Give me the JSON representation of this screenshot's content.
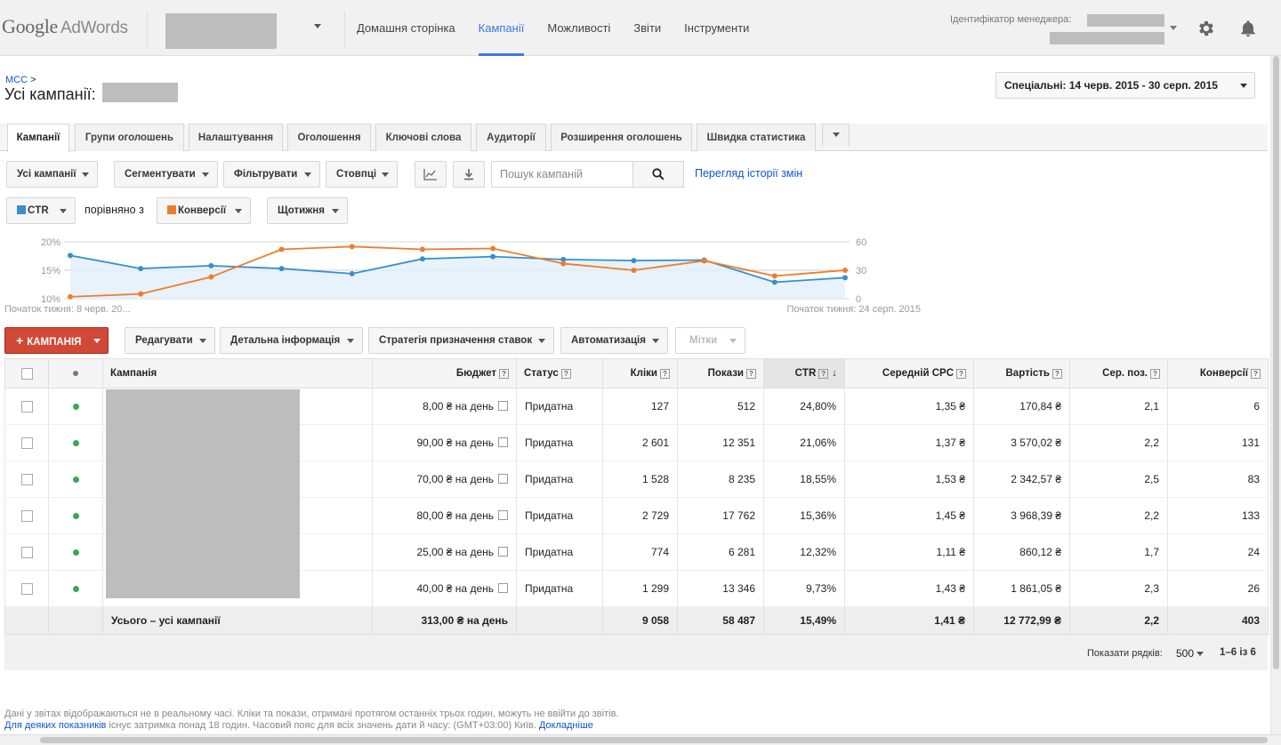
{
  "topbar": {
    "logo_google": "Google",
    "logo_adwords": "AdWords",
    "nav": [
      "Домашня сторінка",
      "Кампанії",
      "Можливості",
      "Звіти",
      "Інструменти"
    ],
    "manager_label": "Ідентифікатор менеджера:"
  },
  "header": {
    "crumb_link": "MCC",
    "crumb_sep": " >",
    "title": "Усі кампанії:",
    "date_range": "Спеціальні: 14 черв. 2015 - 30 серп. 2015"
  },
  "tabs": [
    "Кампанії",
    "Групи оголошень",
    "Налаштування",
    "Оголошення",
    "Ключові слова",
    "Аудиторії",
    "Розширення оголошень",
    "Швидка статистика"
  ],
  "toolbar": {
    "all_campaigns": "Усі кампанії",
    "segment": "Сегментувати",
    "filter": "Фільтрувати",
    "columns": "Стовпці",
    "search_placeholder": "Пошук кампаній",
    "history_link": "Перегляд історії змін"
  },
  "chart_controls": {
    "metric1": "CTR",
    "compare": "порівняно з",
    "metric2": "Конверсії",
    "period": "Щотижня"
  },
  "chart_data": {
    "type": "line",
    "x_start_label": "Початок тижня: 8 черв. 20...",
    "x_end_label": "Початок тижня: 24 серп. 2015",
    "left_axis": {
      "ticks": [
        "20%",
        "15%",
        "10%"
      ],
      "ylim": [
        10,
        20
      ]
    },
    "right_axis": {
      "ticks": [
        "60",
        "30",
        "0"
      ],
      "ylim": [
        0,
        60
      ]
    },
    "series": [
      {
        "name": "CTR",
        "color": "#3a8fcb",
        "axis": "left",
        "values": [
          17.6,
          15.3,
          15.8,
          15.3,
          14.4,
          17.0,
          17.4,
          16.9,
          16.7,
          16.8,
          12.9,
          13.7
        ]
      },
      {
        "name": "Конверсії",
        "color": "#ee7d2b",
        "axis": "right",
        "values": [
          2,
          5,
          23,
          52,
          55,
          52,
          53,
          37,
          30,
          40,
          24,
          30
        ]
      }
    ]
  },
  "actions": {
    "add_campaign": "КАМПАНІЯ",
    "edit": "Редагувати",
    "details": "Детальна інформація",
    "bid_strategy": "Стратегія призначення ставок",
    "automate": "Автоматизація",
    "labels": "Мітки"
  },
  "table": {
    "headers": {
      "campaign": "Кампанія",
      "budget": "Бюджет",
      "status": "Статус",
      "clicks": "Кліки",
      "impressions": "Покази",
      "ctr": "CTR",
      "avg_cpc": "Середній CPC",
      "cost": "Вартість",
      "avg_pos": "Сер. поз.",
      "conversions": "Конверсії"
    },
    "rows": [
      {
        "budget": "8,00 ₴ на день",
        "status": "Придатна",
        "clicks": "127",
        "impressions": "512",
        "ctr": "24,80%",
        "avg_cpc": "1,35 ₴",
        "cost": "170,84 ₴",
        "avg_pos": "2,1",
        "conversions": "6"
      },
      {
        "budget": "90,00 ₴ на день",
        "status": "Придатна",
        "clicks": "2 601",
        "impressions": "12 351",
        "ctr": "21,06%",
        "avg_cpc": "1,37 ₴",
        "cost": "3 570,02 ₴",
        "avg_pos": "2,2",
        "conversions": "131"
      },
      {
        "budget": "70,00 ₴ на день",
        "status": "Придатна",
        "clicks": "1 528",
        "impressions": "8 235",
        "ctr": "18,55%",
        "avg_cpc": "1,53 ₴",
        "cost": "2 342,57 ₴",
        "avg_pos": "2,5",
        "conversions": "83"
      },
      {
        "budget": "80,00 ₴ на день",
        "status": "Придатна",
        "clicks": "2 729",
        "impressions": "17 762",
        "ctr": "15,36%",
        "avg_cpc": "1,45 ₴",
        "cost": "3 968,39 ₴",
        "avg_pos": "2,2",
        "conversions": "133"
      },
      {
        "budget": "25,00 ₴ на день",
        "status": "Придатна",
        "clicks": "774",
        "impressions": "6 281",
        "ctr": "12,32%",
        "avg_cpc": "1,11 ₴",
        "cost": "860,12 ₴",
        "avg_pos": "1,7",
        "conversions": "24"
      },
      {
        "budget": "40,00 ₴ на день",
        "status": "Придатна",
        "clicks": "1 299",
        "impressions": "13 346",
        "ctr": "9,73%",
        "avg_cpc": "1,43 ₴",
        "cost": "1 861,05 ₴",
        "avg_pos": "2,3",
        "conversions": "26"
      }
    ],
    "total": {
      "label": "Усього – усі кампанії",
      "budget": "313,00 ₴ на день",
      "clicks": "9 058",
      "impressions": "58 487",
      "ctr": "15,49%",
      "avg_cpc": "1,41 ₴",
      "cost": "12 772,99 ₴",
      "avg_pos": "2,2",
      "conversions": "403"
    }
  },
  "pagination": {
    "rows_label": "Показати рядків:",
    "rows_value": "500",
    "range": "1–6 із 6"
  },
  "notes": {
    "line1": "Дані у звітах відображаються не в реальному часі. Кліки та покази, отримані протягом останніх трьох годин, можуть не ввійти до звітів.",
    "line2_link": "Для деяких показників",
    "line2_text": " існує затримка понад 18 годин. Часовий пояс для всіх значень дати й часу: (GMT+03:00) Київ. ",
    "line2_more": "Докладніше"
  }
}
